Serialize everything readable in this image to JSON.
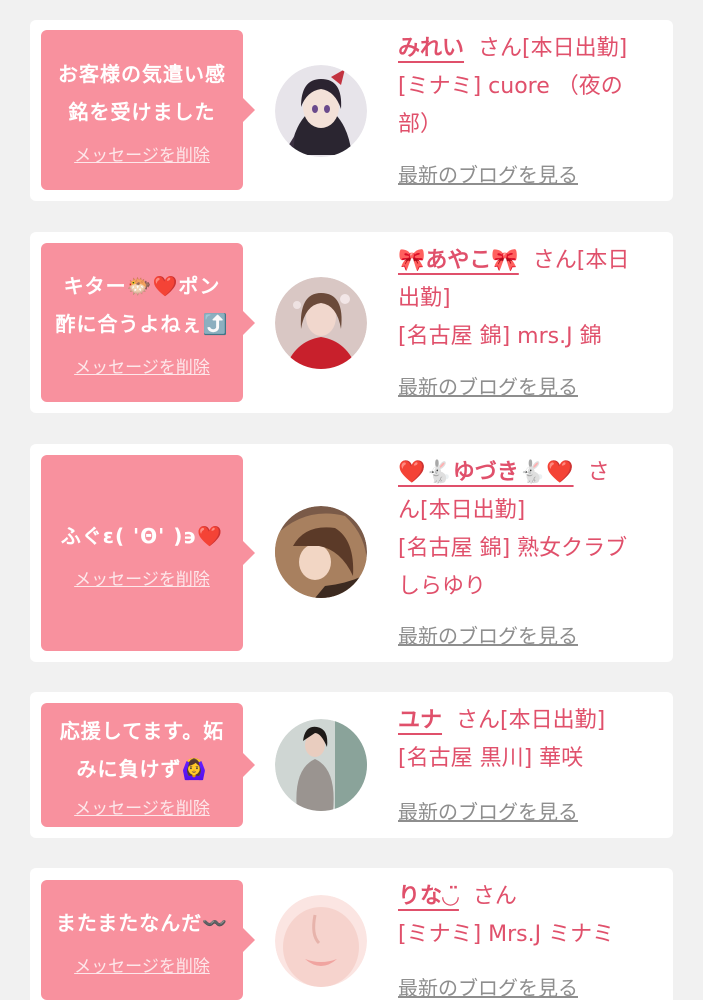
{
  "messages": [
    {
      "message_lines": [
        "お客様の気遣い感",
        "銘を受けました"
      ],
      "delete_label": "メッセージを削除",
      "name": "みれい",
      "san": "さん",
      "status": "[本日出勤]",
      "shop_lines": [
        "[ミナミ] cuore （夜の",
        "部）"
      ],
      "blog_label": "最新のブログを見る",
      "avatar_icon": "anime-character-avatar-icon"
    },
    {
      "message_lines": [
        "キター🐡❤️ポン",
        "酢に合うよねぇ⤴️"
      ],
      "delete_label": "メッセージを削除",
      "name_first_line": "🎀あやこ🎀",
      "name_suffix": "さん[本日",
      "name_second_line": "出勤]",
      "shop_lines": [
        "[名古屋 錦] mrs.J 錦"
      ],
      "blog_label": "最新のブログを見る",
      "avatar_icon": "woman-photo-avatar-icon"
    },
    {
      "message_lines": [
        "ふぐɛ( 'Θ' )϶❤️"
      ],
      "delete_label": "メッセージを削除",
      "name_first_line": "❤️🐇ゆづき🐇❤️",
      "name_suffix": "さ",
      "name_second_line": "ん[本日出勤]",
      "shop_lines": [
        "[名古屋 錦] 熟女クラブ",
        "しらゆり"
      ],
      "blog_label": "最新のブログを見る",
      "avatar_icon": "woman-photo-avatar-icon"
    },
    {
      "message_lines": [
        "応援してます。妬",
        "みに負けず🙆‍♀️"
      ],
      "delete_label": "メッセージを削除",
      "name": "ユナ",
      "san": "さん[本日出勤]",
      "shop_lines": [
        "[名古屋 黒川] 華咲"
      ],
      "blog_label": "最新のブログを見る",
      "avatar_icon": "woman-photo-avatar-icon"
    },
    {
      "message_lines": [
        "またまたなんだ〰️"
      ],
      "delete_label": "メッセージを削除",
      "name": "りな◡̈",
      "san": "さん",
      "shop_lines": [
        "[ミナミ] Mrs.J ミナミ"
      ],
      "blog_label": "最新のブログを見る",
      "avatar_icon": "woman-photo-avatar-icon"
    }
  ],
  "colors": {
    "background": "#f1f1f1",
    "card": "#ffffff",
    "bubble": "#f8919e",
    "accent_pink": "#e0506b",
    "link_gray": "#8e8e8e"
  }
}
